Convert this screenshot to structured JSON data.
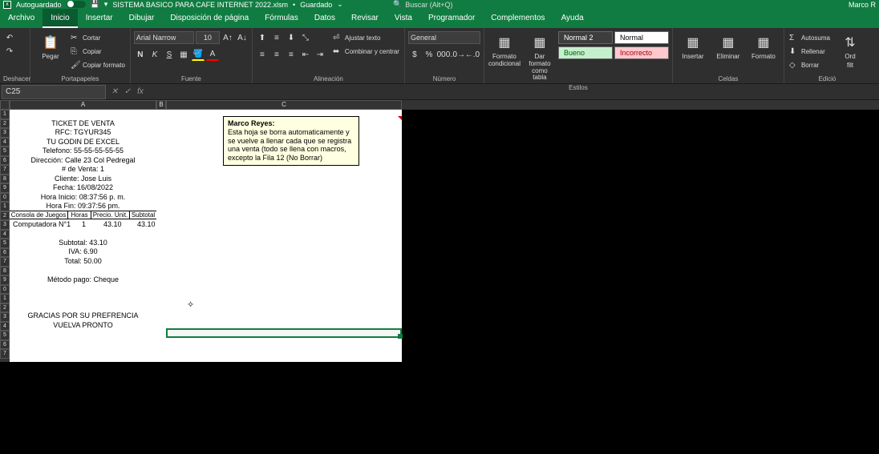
{
  "titlebar": {
    "autosave_label": "Autoguardado",
    "filename": "SISTEMA BASICO PARA CAFE INTERNET 2022.xlsm",
    "save_status": "Guardado",
    "search_placeholder": "Buscar (Alt+Q)",
    "user": "Marco R"
  },
  "menu": {
    "archivo": "Archivo",
    "inicio": "Inicio",
    "insertar": "Insertar",
    "dibujar": "Dibujar",
    "disposicion": "Disposición de página",
    "formulas": "Fórmulas",
    "datos": "Datos",
    "revisar": "Revisar",
    "vista": "Vista",
    "programador": "Programador",
    "complementos": "Complementos",
    "ayuda": "Ayuda"
  },
  "ribbon": {
    "deshacer_label": "Deshacer",
    "portapapeles_label": "Portapapeles",
    "pegar": "Pegar",
    "cortar": "Cortar",
    "copiar": "Copiar",
    "copiar_formato": "Copiar formato",
    "fuente_label": "Fuente",
    "font_name": "Arial Narrow",
    "font_size": "10",
    "alineacion_label": "Alineación",
    "ajustar_texto": "Ajustar texto",
    "combinar": "Combinar y centrar",
    "numero_label": "Número",
    "num_format": "General",
    "estilos_label": "Estilos",
    "formato_cond": "Formato condicional",
    "dar_formato": "Dar formato como tabla",
    "style_normal2": "Normal 2",
    "style_normal": "Normal",
    "style_bueno": "Bueno",
    "style_incorrecto": "Incorrecto",
    "celdas_label": "Celdas",
    "insertar_btn": "Insertar",
    "eliminar_btn": "Eliminar",
    "formato_btn": "Formato",
    "edicion_label": "Edició",
    "autosuma": "Autosuma",
    "rellenar": "Rellenar",
    "borrar": "Borrar",
    "ord": "Ord",
    "filt": "filt"
  },
  "formula": {
    "cell_ref": "C25",
    "value": ""
  },
  "columns": {
    "a": "A",
    "b": "B",
    "c": "C"
  },
  "rows": [
    "1",
    "2",
    "3",
    "4",
    "5",
    "6",
    "7",
    "8",
    "9",
    "0",
    "1",
    "2",
    "3",
    "4",
    "5",
    "6",
    "7",
    "8",
    "9",
    "0",
    "1",
    "2",
    "3",
    "4",
    "5",
    "6",
    "7"
  ],
  "ticket": {
    "title": "TICKET DE VENTA",
    "rfc": "RFC: TGYUR345",
    "sub": "TU GODIN DE EXCEL",
    "tel": "Telefono: 55-55-55-55-55",
    "dir": "Dirección: Calle 23 Col Pedregal",
    "venta": "# de Venta: 1",
    "cliente": "Cliente: Jose Luis",
    "fecha": "Fecha: 16/08/2022",
    "inicio": "Hora Inicio: 08:37:56 p. m.",
    "fin": "Hora Fin: 09:37:56 pm.",
    "th_consola": "Consola de Juegos",
    "th_horas": "Horas",
    "th_precio": "Precio. Unit.",
    "th_sub": "Subtotal",
    "item_name": "Computadora N°1",
    "item_horas": "1",
    "item_precio": "43.10",
    "item_sub": "43.10",
    "subtotal": "Subtotal: 43.10",
    "iva": "IVA: 6.90",
    "total": "Total: 50.00",
    "pago": "Método pago: Cheque",
    "gracias": "GRACIAS POR SU PREFRENCIA",
    "vuelva": "VUELVA PRONTO"
  },
  "comment": {
    "author": "Marco Reyes:",
    "text": "Esta hoja se borra automaticamente y se vuelve a llenar cada que se registra una venta (todo se llena con macros, excepto la Fila 12 (No Borrar)"
  }
}
